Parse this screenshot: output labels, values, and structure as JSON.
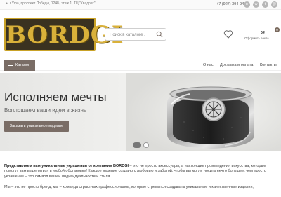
{
  "topbar": {
    "address": "г.Уфа, проспект Победы, 124Б, этаж 1, ТЦ \"Квадрат\"",
    "phone": "+7 (927) 394-94-49",
    "socials": [
      {
        "icon": "vk-icon",
        "glyph": "в"
      },
      {
        "icon": "whatsapp-icon",
        "glyph": "w"
      },
      {
        "icon": "telegram-icon",
        "glyph": "t"
      },
      {
        "icon": "email-icon",
        "glyph": "@"
      }
    ]
  },
  "header": {
    "logo_text": "BORDGI",
    "search_placeholder": "Поиск в каталоге .",
    "cart_count": "0",
    "cart_sum": "0₽",
    "checkout_label": "Оформить заказ"
  },
  "nav": {
    "catalog_label": "Каталог",
    "links": [
      "О нас",
      "Доставка и оплата",
      "Контакты"
    ]
  },
  "banner": {
    "headline": "Исполняем мечты",
    "subline": "Воплощаем ваши идеи в жизнь",
    "cta": "Заказать уникальное изделие",
    "slides_count": 2,
    "active_slide": 1
  },
  "content": {
    "intro_bold": "Представляем вам уникальные украшения от компании BORDGI",
    "intro_rest": " – это не просто аксессуары, а настоящие произведения искусства, которые помогут вам выделиться в любой обстановке! Каждое изделие создано с любовью и заботой, чтобы вы могли носить нечто большее, чем просто украшение – это символ вашей индивидуальности и стиля.",
    "para2": "Мы – это не просто бренд, мы – команда страстных профессионалов, которые стремятся создавать уникальные и качественные изделия,"
  },
  "colors": {
    "accent": "#7a6d66",
    "logo_gold": "#d9b13a",
    "banner_bg": "#e8e8e6"
  }
}
